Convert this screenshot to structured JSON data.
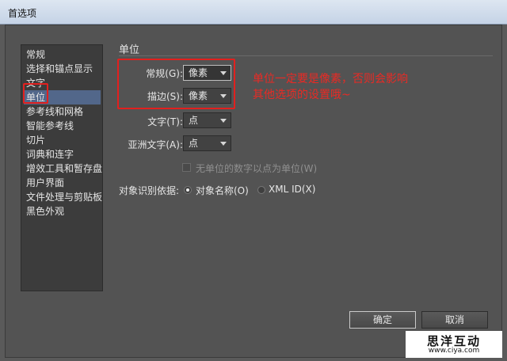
{
  "window": {
    "title": "首选项"
  },
  "sidebar": {
    "items": [
      {
        "label": "常规",
        "selected": false
      },
      {
        "label": "选择和锚点显示",
        "selected": false
      },
      {
        "label": "文字",
        "selected": false
      },
      {
        "label": "单位",
        "selected": true
      },
      {
        "label": "参考线和网格",
        "selected": false
      },
      {
        "label": "智能参考线",
        "selected": false
      },
      {
        "label": "切片",
        "selected": false
      },
      {
        "label": "词典和连字",
        "selected": false
      },
      {
        "label": "增效工具和暂存盘",
        "selected": false
      },
      {
        "label": "用户界面",
        "selected": false
      },
      {
        "label": "文件处理与剪贴板",
        "selected": false
      },
      {
        "label": "黑色外观",
        "selected": false
      }
    ]
  },
  "section": {
    "title": "单位"
  },
  "fields": {
    "general": {
      "label": "常规(G):",
      "value": "像素"
    },
    "stroke": {
      "label": "描边(S):",
      "value": "像素"
    },
    "type": {
      "label": "文字(T):",
      "value": "点"
    },
    "asian_type": {
      "label": "亚洲文字(A):",
      "value": "点"
    }
  },
  "checkbox": {
    "label": "无单位的数字以点为单位(W)",
    "checked": false,
    "enabled": false
  },
  "identify": {
    "label": "对象识别依据:",
    "options": [
      {
        "label": "对象名称(O)",
        "selected": true
      },
      {
        "label": "XML ID(X)",
        "selected": false
      }
    ]
  },
  "annotation": {
    "line1": "单位一定要是像素，否则会影响",
    "line2": "其他选项的设置哦~",
    "color": "#ea2a24"
  },
  "buttons": {
    "ok": "确定",
    "cancel": "取消"
  },
  "watermark": {
    "name": "思洋互动",
    "url": "www.ciya.com"
  }
}
